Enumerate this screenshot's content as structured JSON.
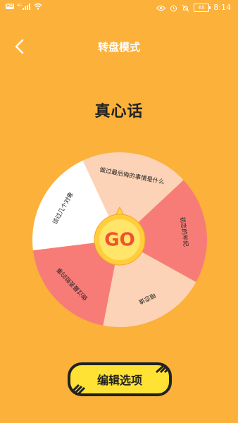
{
  "status_bar": {
    "hd": "HD",
    "network": "4G",
    "battery": "65",
    "time": "8:14"
  },
  "header": {
    "title": "转盘模式",
    "back_icon": "chevron-left-icon"
  },
  "question": "真心话",
  "wheel": {
    "center_label": "GO",
    "segments": [
      {
        "text": "做过最后悔的事情是什么",
        "color": "#FCD3B6"
      },
      {
        "text": "初恋的年纪",
        "color": "#F77C78"
      },
      {
        "text": "暗恋谁",
        "color": "#FCD3B6"
      },
      {
        "text": "做过最丢脸的事",
        "color": "#F77C78"
      },
      {
        "text": "谈过几个对象",
        "color": "#FFFFFF"
      }
    ]
  },
  "edit_button": {
    "label": "编辑选项"
  },
  "colors": {
    "background": "#FBB13A",
    "segment_pink": "#F77C78",
    "segment_peach": "#FCD3B6",
    "button_yellow": "#FFE234",
    "center_ring": "#FFCE3A"
  }
}
